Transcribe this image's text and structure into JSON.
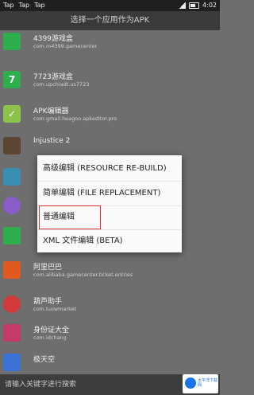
{
  "status_bar": {
    "left_items": [
      "Tap",
      "Tap",
      "Tap"
    ],
    "time": "4:02"
  },
  "header": {
    "title": "选择一个应用作为APK"
  },
  "apps": [
    {
      "name": "4399游戏盒",
      "package": "com.m4399.gamecenter",
      "icon_color": "#2fae4e",
      "icon_glyph": ""
    },
    {
      "name": "7723游戏盒",
      "package": "com.upchiadt.us7723",
      "icon_color": "#2fae4e",
      "icon_glyph": "7"
    },
    {
      "name": "APK编辑器",
      "package": "com.gmail.heagoo.apkeditor.pro",
      "icon_color": "#8bc34a",
      "icon_glyph": "✓"
    },
    {
      "name": "Injustice 2",
      "package": "",
      "icon_color": "#5a4633",
      "icon_glyph": ""
    },
    {
      "name": "",
      "package": "",
      "icon_color": "#3a8fb0",
      "icon_glyph": ""
    },
    {
      "name": "",
      "package": "",
      "icon_color": "#8a5cc9",
      "icon_glyph": ""
    },
    {
      "name": "",
      "package": "",
      "icon_color": "#2fae4e",
      "icon_glyph": ""
    },
    {
      "name": "阿里巴巴",
      "package": "com.alibaba.gamecenter.ticket.entries",
      "icon_color": "#e05a1f",
      "icon_glyph": ""
    },
    {
      "name": "葫芦助手",
      "package": "com.luowmarket",
      "icon_color": "#d23a3a",
      "icon_glyph": ""
    },
    {
      "name": "身份证大全",
      "package": "com.idchang",
      "icon_color": "#c23b6a",
      "icon_glyph": ""
    },
    {
      "name": "极天空",
      "package": "",
      "icon_color": "#3b74d6",
      "icon_glyph": ""
    }
  ],
  "menu": {
    "items": [
      "高级编辑 (RESOURCE RE-BUILD)",
      "简单编辑 (FILE REPLACEMENT)",
      "普通编辑",
      "XML 文件编辑 (BETA)"
    ],
    "highlight_color": "#d9323a"
  },
  "bottom_bar": {
    "placeholder": "请输入关键字进行搜索"
  },
  "watermark": {
    "text": "太平洋下载网"
  }
}
